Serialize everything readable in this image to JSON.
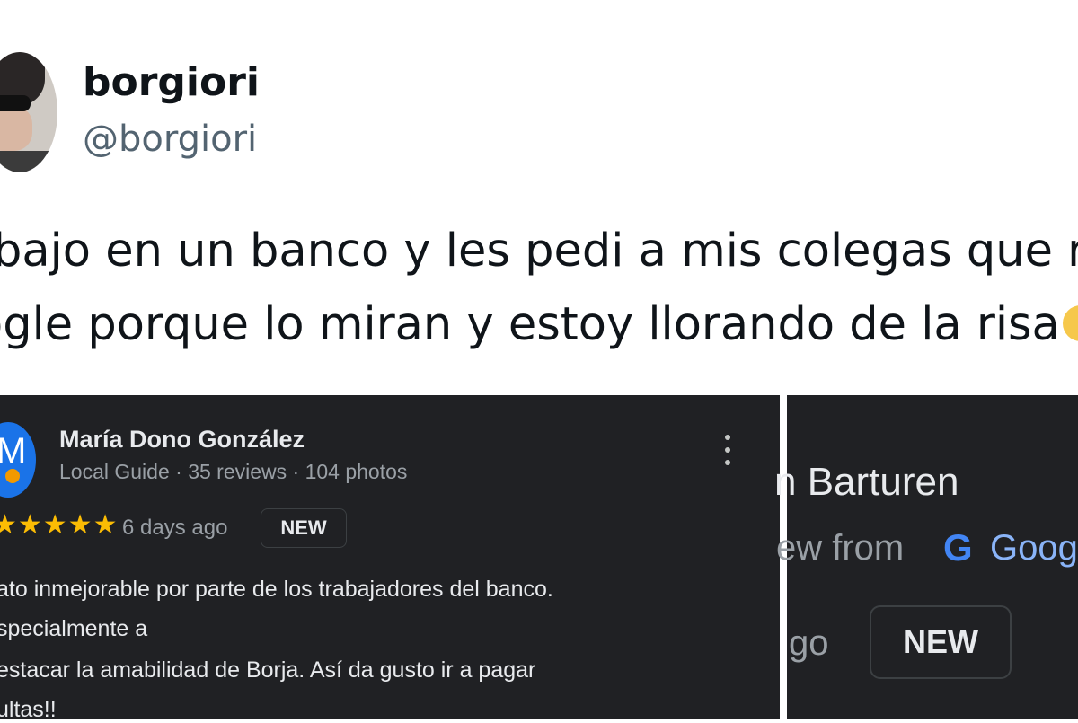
{
  "tweet": {
    "author_name": "borgiori",
    "author_handle": "@borgiori",
    "text_line1": "bajo en un banco y les pedi a mis colegas que r",
    "text_line2": "ogle porque lo miran y estoy llorando de la risa"
  },
  "review_left": {
    "reviewer_name": "María Dono González",
    "reviewer_meta": "Local Guide · 35 reviews · 104 photos",
    "stars": "★★★★★",
    "rating": 5,
    "time": "6 days ago",
    "badge": "NEW",
    "text_line1": "ato inmejorable por parte de los trabajadores del banco.",
    "text_line2": "specialmente a",
    "text_line3": "estacar la amabilidad de Borja. Así da gusto ir a pagar",
    "text_line4": "ultas!!"
  },
  "review_right": {
    "reviewer_name_partial": "n Barturen",
    "source_partial": "ew from",
    "google_letter": "G",
    "google_partial": "Goog",
    "time_partial": "go",
    "badge": "NEW"
  }
}
